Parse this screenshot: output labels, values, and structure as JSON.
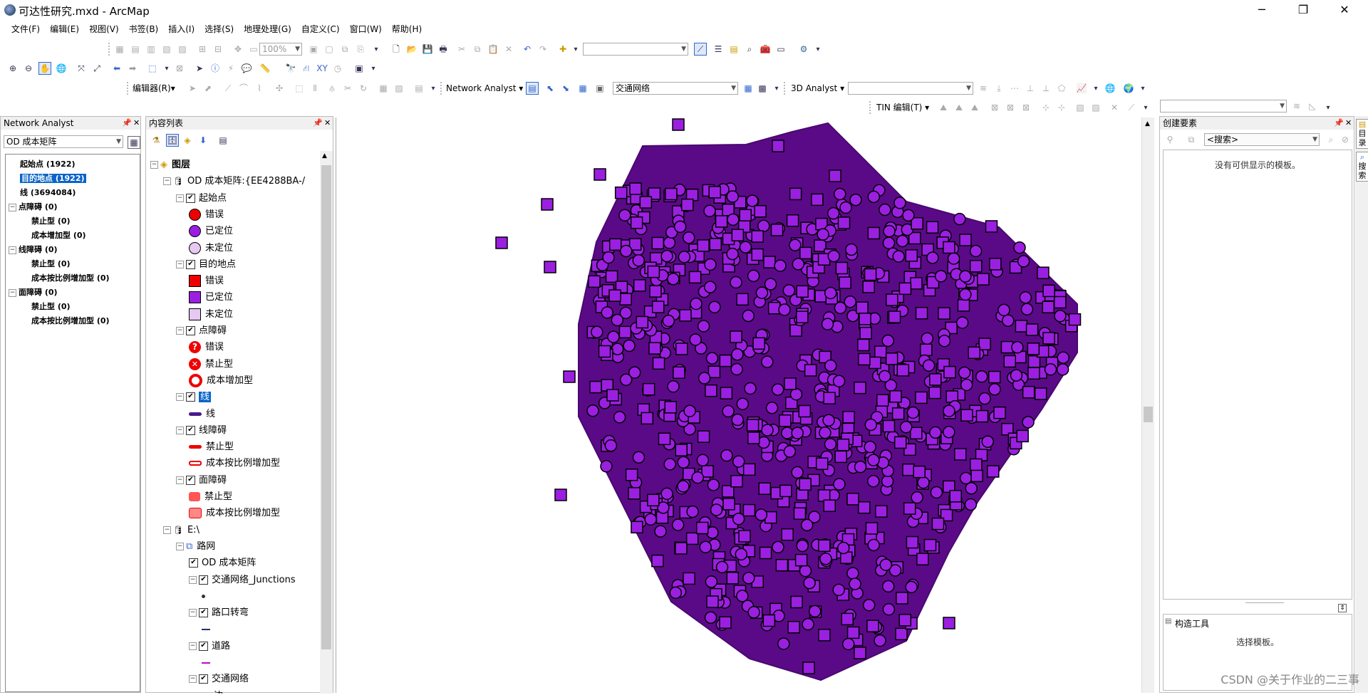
{
  "window": {
    "title": "可达性研究.mxd - ArcMap",
    "controls": {
      "minimize": "─",
      "restore": "❐",
      "close": "✕"
    }
  },
  "menu": [
    "文件(F)",
    "编辑(E)",
    "视图(V)",
    "书签(B)",
    "插入(I)",
    "选择(S)",
    "地理处理(G)",
    "自定义(C)",
    "窗口(W)",
    "帮助(H)"
  ],
  "toolbars": {
    "zoom_value": "100%",
    "editor_label": "编辑器(R)▾",
    "network_analyst_label": "Network Analyst ▾",
    "network_dataset": "交通网络",
    "analyst3d_label": "3D Analyst ▾",
    "tin_editor_label": "TIN 编辑(T) ▾"
  },
  "network_analyst_panel": {
    "title": "Network Analyst",
    "analysis_layer": "OD 成本矩阵",
    "items": [
      {
        "label": "起始点 (1922)",
        "indent": 0,
        "expander": false,
        "selected": false
      },
      {
        "label": "目的地点 (1922)",
        "indent": 0,
        "expander": false,
        "selected": true
      },
      {
        "label": "线 (3694084)",
        "indent": 0,
        "expander": false,
        "selected": false
      },
      {
        "label": "点障碍 (0)",
        "indent": 0,
        "expander": true,
        "selected": false
      },
      {
        "label": "禁止型 (0)",
        "indent": 1,
        "expander": false,
        "selected": false
      },
      {
        "label": "成本增加型 (0)",
        "indent": 1,
        "expander": false,
        "selected": false
      },
      {
        "label": "线障碍 (0)",
        "indent": 0,
        "expander": true,
        "selected": false
      },
      {
        "label": "禁止型 (0)",
        "indent": 1,
        "expander": false,
        "selected": false
      },
      {
        "label": "成本按比例增加型 (0)",
        "indent": 1,
        "expander": false,
        "selected": false
      },
      {
        "label": "面障碍 (0)",
        "indent": 0,
        "expander": true,
        "selected": false
      },
      {
        "label": "禁止型 (0)",
        "indent": 1,
        "expander": false,
        "selected": false
      },
      {
        "label": "成本按比例增加型 (0)",
        "indent": 1,
        "expander": false,
        "selected": false
      }
    ]
  },
  "toc_panel": {
    "title": "内容列表",
    "rows": [
      {
        "label": "图层",
        "kind": "root",
        "indent": 0,
        "expander": "⊟",
        "check": "",
        "sym": "layers"
      },
      {
        "label": "OD 成本矩阵:{EE4288BA-/",
        "kind": "group",
        "indent": 1,
        "expander": "⊟",
        "check": "",
        "sym": "db"
      },
      {
        "label": "起始点",
        "kind": "layer",
        "indent": 2,
        "expander": "⊟",
        "check": "✔",
        "sym": ""
      },
      {
        "label": "错误",
        "kind": "legend",
        "indent": 3,
        "expander": "",
        "check": "",
        "sym": "red-circle"
      },
      {
        "label": "已定位",
        "kind": "legend",
        "indent": 3,
        "expander": "",
        "check": "",
        "sym": "purple-circle"
      },
      {
        "label": "未定位",
        "kind": "legend",
        "indent": 3,
        "expander": "",
        "check": "",
        "sym": "q-circle"
      },
      {
        "label": "目的地点",
        "kind": "layer",
        "indent": 2,
        "expander": "⊟",
        "check": "✔",
        "sym": ""
      },
      {
        "label": "错误",
        "kind": "legend",
        "indent": 3,
        "expander": "",
        "check": "",
        "sym": "red-square"
      },
      {
        "label": "已定位",
        "kind": "legend",
        "indent": 3,
        "expander": "",
        "check": "",
        "sym": "purple-square"
      },
      {
        "label": "未定位",
        "kind": "legend",
        "indent": 3,
        "expander": "",
        "check": "",
        "sym": "q-square"
      },
      {
        "label": "点障碍",
        "kind": "layer",
        "indent": 2,
        "expander": "⊟",
        "check": "✔",
        "sym": ""
      },
      {
        "label": "错误",
        "kind": "legend",
        "indent": 3,
        "expander": "",
        "check": "",
        "sym": "red-question"
      },
      {
        "label": "禁止型",
        "kind": "legend",
        "indent": 3,
        "expander": "",
        "check": "",
        "sym": "red-x"
      },
      {
        "label": "成本增加型",
        "kind": "legend",
        "indent": 3,
        "expander": "",
        "check": "",
        "sym": "red-ring"
      },
      {
        "label": "线",
        "kind": "layer-selected",
        "indent": 2,
        "expander": "⊟",
        "check": "✔",
        "sym": ""
      },
      {
        "label": "线",
        "kind": "legend",
        "indent": 3,
        "expander": "",
        "check": "",
        "sym": "purple-line"
      },
      {
        "label": "线障碍",
        "kind": "layer",
        "indent": 2,
        "expander": "⊟",
        "check": "✔",
        "sym": ""
      },
      {
        "label": "禁止型",
        "kind": "legend",
        "indent": 3,
        "expander": "",
        "check": "",
        "sym": "red-line"
      },
      {
        "label": "成本按比例增加型",
        "kind": "legend",
        "indent": 3,
        "expander": "",
        "check": "",
        "sym": "red-line-hollow"
      },
      {
        "label": "面障碍",
        "kind": "layer",
        "indent": 2,
        "expander": "⊟",
        "check": "✔",
        "sym": ""
      },
      {
        "label": "禁止型",
        "kind": "legend",
        "indent": 3,
        "expander": "",
        "check": "",
        "sym": "red-poly"
      },
      {
        "label": "成本按比例增加型",
        "kind": "legend",
        "indent": 3,
        "expander": "",
        "check": "",
        "sym": "red-poly2"
      },
      {
        "label": "E:\\",
        "kind": "group",
        "indent": 1,
        "expander": "⊟",
        "check": "",
        "sym": "db"
      },
      {
        "label": "路网",
        "kind": "group",
        "indent": 2,
        "expander": "⊟",
        "check": "",
        "sym": "net"
      },
      {
        "label": "OD 成本矩阵",
        "kind": "layer",
        "indent": 3,
        "expander": "",
        "check": "✔",
        "sym": ""
      },
      {
        "label": "交通网络_Junctions",
        "kind": "layer",
        "indent": 3,
        "expander": "⊟",
        "check": "✔",
        "sym": ""
      },
      {
        "label": "",
        "kind": "legend",
        "indent": 4,
        "expander": "",
        "check": "",
        "sym": "dot"
      },
      {
        "label": "路口转弯",
        "kind": "layer",
        "indent": 3,
        "expander": "⊟",
        "check": "✔",
        "sym": ""
      },
      {
        "label": "",
        "kind": "legend",
        "indent": 4,
        "expander": "",
        "check": "",
        "sym": "teal-line"
      },
      {
        "label": "道路",
        "kind": "layer",
        "indent": 3,
        "expander": "⊟",
        "check": "✔",
        "sym": ""
      },
      {
        "label": "",
        "kind": "legend",
        "indent": 4,
        "expander": "",
        "check": "",
        "sym": "magenta-line"
      },
      {
        "label": "交通网络",
        "kind": "layer",
        "indent": 3,
        "expander": "⊟",
        "check": "✔",
        "sym": ""
      },
      {
        "label": "— 边",
        "kind": "legend",
        "indent": 4,
        "expander": "",
        "check": "",
        "sym": ""
      }
    ]
  },
  "create_features_panel": {
    "title": "创建要素",
    "search_placeholder": "<搜索>",
    "empty_text": "没有可供显示的模板。",
    "construct_title": "构造工具",
    "construct_text": "选择模板。"
  },
  "side_tabs": [
    "目录",
    "搜索"
  ],
  "watermark": "CSDN @关于作业的二三事",
  "colors": {
    "od_lines": "#5a0a87",
    "point_fill": "#9b1fe0",
    "selection": "#0a64c8"
  }
}
